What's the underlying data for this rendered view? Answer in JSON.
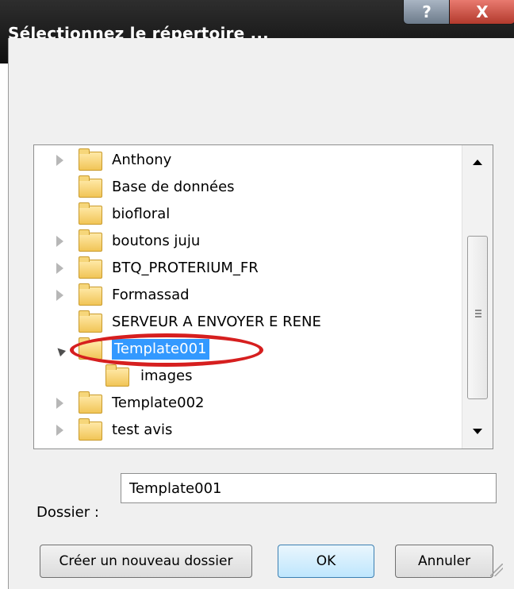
{
  "window": {
    "title": "Sélectionnez le répertoire ...",
    "help_label": "?",
    "close_label": "X"
  },
  "tree": {
    "items": [
      {
        "label": "Anthony",
        "expander": "collapsed",
        "level": 0,
        "selected": false
      },
      {
        "label": "Base de données",
        "expander": "none",
        "level": 0,
        "selected": false
      },
      {
        "label": "biofloral",
        "expander": "none",
        "level": 0,
        "selected": false
      },
      {
        "label": "boutons juju",
        "expander": "collapsed",
        "level": 0,
        "selected": false
      },
      {
        "label": "BTQ_PROTERIUM_FR",
        "expander": "collapsed",
        "level": 0,
        "selected": false
      },
      {
        "label": "Formassad",
        "expander": "collapsed",
        "level": 0,
        "selected": false
      },
      {
        "label": "SERVEUR A ENVOYER E RENE",
        "expander": "none",
        "level": 0,
        "selected": false
      },
      {
        "label": "Template001",
        "expander": "expanded",
        "level": 0,
        "selected": true
      },
      {
        "label": "images",
        "expander": "none",
        "level": 1,
        "selected": false
      },
      {
        "label": "Template002",
        "expander": "collapsed",
        "level": 0,
        "selected": false
      },
      {
        "label": "test avis",
        "expander": "collapsed",
        "level": 0,
        "selected": false
      }
    ]
  },
  "folder_field": {
    "label": "Dossier :",
    "value": "Template001"
  },
  "buttons": {
    "new_folder": "Créer un nouveau dossier",
    "ok": "OK",
    "cancel": "Annuler"
  },
  "annotation": {
    "color": "#d61f1f"
  }
}
